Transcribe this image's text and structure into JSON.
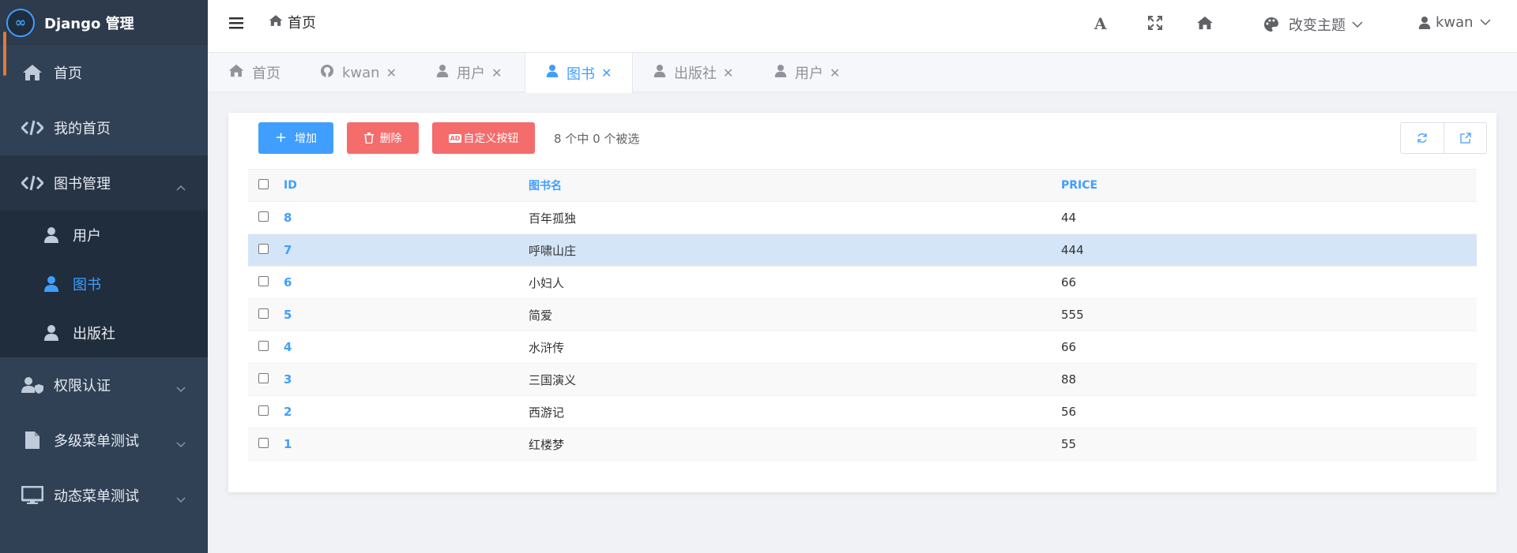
{
  "app": {
    "title": "Django 管理",
    "logo_glyph": "∞"
  },
  "colors": {
    "sidebar": "#304156",
    "accent": "#409eff",
    "danger": "#f56c6c",
    "row_highlight": "#d4e5f7"
  },
  "sidebar": {
    "home": "首页",
    "my_home": "我的首页",
    "book_mgmt": "图书管理",
    "sub": [
      "用户",
      "图书",
      "出版社"
    ],
    "perm": "权限认证",
    "multi": "多级菜单测试",
    "dynamic": "动态菜单测试"
  },
  "header": {
    "breadcrumb": "首页",
    "font_icon": "A",
    "theme": "改变主题",
    "user": "kwan"
  },
  "tabs": [
    "首页",
    "kwan",
    "用户",
    "图书",
    "出版社",
    "用户"
  ],
  "toolbar": {
    "add": "增加",
    "delete": "删除",
    "custom": "自定义按钮",
    "custom_badge": "AD",
    "selection": "8 个中 0 个被选"
  },
  "table": {
    "headers": [
      "ID",
      "图书名",
      "PRICE"
    ],
    "rows": [
      {
        "id": "8",
        "name": "百年孤独",
        "price": "44"
      },
      {
        "id": "7",
        "name": "呼啸山庄",
        "price": "444"
      },
      {
        "id": "6",
        "name": "小妇人",
        "price": "66"
      },
      {
        "id": "5",
        "name": "简爱",
        "price": "555"
      },
      {
        "id": "4",
        "name": "水浒传",
        "price": "66"
      },
      {
        "id": "3",
        "name": "三国演义",
        "price": "88"
      },
      {
        "id": "2",
        "name": "西游记",
        "price": "56"
      },
      {
        "id": "1",
        "name": "红楼梦",
        "price": "55"
      }
    ]
  }
}
